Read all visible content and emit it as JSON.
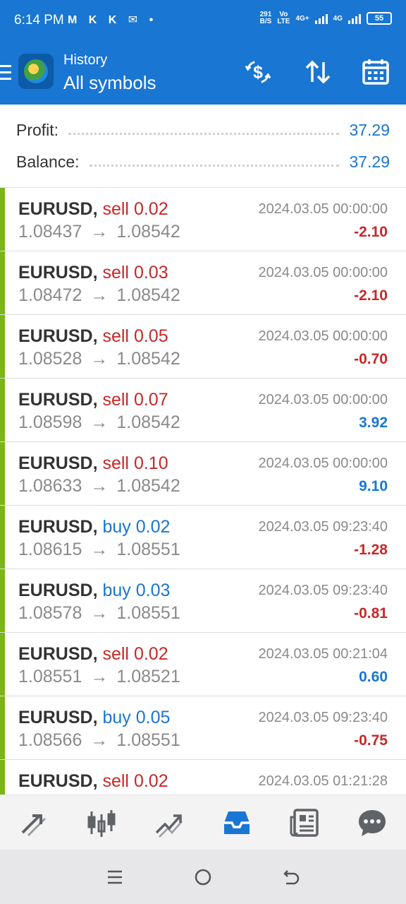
{
  "status_bar": {
    "time": "6:14 PM",
    "left_icons": "M K K ✉ •",
    "net_speed_value": "291",
    "net_speed_unit": "B/S",
    "volte_top": "Vo",
    "volte_bottom": "LTE",
    "network_1": "4G+",
    "network_2": "4G",
    "battery": "55"
  },
  "app_bar": {
    "subtitle": "History",
    "title": "All symbols",
    "icons": [
      "hamburger-icon",
      "metatrader-logo",
      "dollar-refresh-icon",
      "sort-icon",
      "calendar-icon"
    ]
  },
  "summary": {
    "profit_label": "Profit:",
    "profit_value": "37.29",
    "balance_label": "Balance:",
    "balance_value": "37.29"
  },
  "trades": [
    {
      "symbol": "EURUSD,",
      "type": "sell",
      "volume": "0.02",
      "open": "1.08437",
      "close": "1.08542",
      "time": "2024.03.05 00:00:00",
      "profit": "-2.10"
    },
    {
      "symbol": "EURUSD,",
      "type": "sell",
      "volume": "0.03",
      "open": "1.08472",
      "close": "1.08542",
      "time": "2024.03.05 00:00:00",
      "profit": "-2.10"
    },
    {
      "symbol": "EURUSD,",
      "type": "sell",
      "volume": "0.05",
      "open": "1.08528",
      "close": "1.08542",
      "time": "2024.03.05 00:00:00",
      "profit": "-0.70"
    },
    {
      "symbol": "EURUSD,",
      "type": "sell",
      "volume": "0.07",
      "open": "1.08598",
      "close": "1.08542",
      "time": "2024.03.05 00:00:00",
      "profit": "3.92"
    },
    {
      "symbol": "EURUSD,",
      "type": "sell",
      "volume": "0.10",
      "open": "1.08633",
      "close": "1.08542",
      "time": "2024.03.05 00:00:00",
      "profit": "9.10"
    },
    {
      "symbol": "EURUSD,",
      "type": "buy",
      "volume": "0.02",
      "open": "1.08615",
      "close": "1.08551",
      "time": "2024.03.05 09:23:40",
      "profit": "-1.28"
    },
    {
      "symbol": "EURUSD,",
      "type": "buy",
      "volume": "0.03",
      "open": "1.08578",
      "close": "1.08551",
      "time": "2024.03.05 09:23:40",
      "profit": "-0.81"
    },
    {
      "symbol": "EURUSD,",
      "type": "sell",
      "volume": "0.02",
      "open": "1.08551",
      "close": "1.08521",
      "time": "2024.03.05 00:21:04",
      "profit": "0.60"
    },
    {
      "symbol": "EURUSD,",
      "type": "buy",
      "volume": "0.05",
      "open": "1.08566",
      "close": "1.08551",
      "time": "2024.03.05 09:23:40",
      "profit": "-0.75"
    },
    {
      "symbol": "EURUSD,",
      "type": "sell",
      "volume": "0.02",
      "open": "",
      "close": "",
      "time": "2024.03.05 01:21:28",
      "profit": ""
    }
  ],
  "arrow_glyph": "→",
  "bottom_tabs": [
    {
      "name": "quotes-tab",
      "icon": "quotes-arrows-icon",
      "active": false
    },
    {
      "name": "chart-tab",
      "icon": "candlestick-icon",
      "active": false
    },
    {
      "name": "trade-tab",
      "icon": "trend-icon",
      "active": false
    },
    {
      "name": "history-tab",
      "icon": "inbox-icon",
      "active": true
    },
    {
      "name": "news-tab",
      "icon": "newspaper-icon",
      "active": false
    },
    {
      "name": "messages-tab",
      "icon": "chat-icon",
      "active": false
    }
  ],
  "colors": {
    "primary": "#1976d2",
    "loss": "#c62828",
    "accent_bar": "#7cb518",
    "inactive_icon": "#5f6368"
  }
}
